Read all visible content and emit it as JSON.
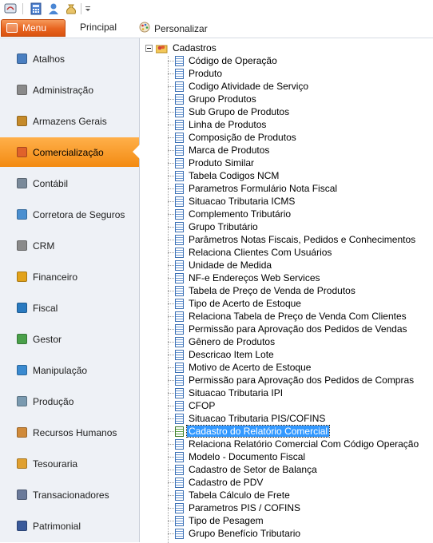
{
  "toolbar": {
    "icons": [
      "app-icon",
      "calculator-icon",
      "user-icon",
      "money-bag-icon",
      "customize-dropdown-icon"
    ]
  },
  "tabs": {
    "menu_label": "Menu",
    "principal_label": "Principal",
    "personalizar_label": "Personalizar"
  },
  "nav": {
    "active_index": 3,
    "items": [
      {
        "label": "Atalhos",
        "icon": "shortcut-icon",
        "color": "#4a7fc1"
      },
      {
        "label": "Administração",
        "icon": "admin-icon",
        "color": "#8a8a8a"
      },
      {
        "label": "Armazens Gerais",
        "icon": "warehouse-icon",
        "color": "#c58a2a"
      },
      {
        "label": "Comercialização",
        "icon": "store-icon",
        "color": "#e0622a"
      },
      {
        "label": "Contábil",
        "icon": "ledger-icon",
        "color": "#7a8a9a"
      },
      {
        "label": "Corretora de Seguros",
        "icon": "insurance-icon",
        "color": "#4a8fd0"
      },
      {
        "label": "CRM",
        "icon": "crm-icon",
        "color": "#8a8a8a"
      },
      {
        "label": "Financeiro",
        "icon": "coin-icon",
        "color": "#e2a21a"
      },
      {
        "label": "Fiscal",
        "icon": "fiscal-book-icon",
        "color": "#2a7ac0"
      },
      {
        "label": "Gestor",
        "icon": "chart-icon",
        "color": "#4aa04a"
      },
      {
        "label": "Manipulação",
        "icon": "capsule-icon",
        "color": "#3a8ad0"
      },
      {
        "label": "Produção",
        "icon": "factory-icon",
        "color": "#7a9ab0"
      },
      {
        "label": "Recursos Humanos",
        "icon": "people-icon",
        "color": "#d08a3a"
      },
      {
        "label": "Tesouraria",
        "icon": "treasury-icon",
        "color": "#e0a030"
      },
      {
        "label": "Transacionadores",
        "icon": "handshake-icon",
        "color": "#6a7a9a"
      },
      {
        "label": "Patrimonial",
        "icon": "asset-icon",
        "color": "#3a5a9a"
      }
    ]
  },
  "tree": {
    "root_label": "Cadastros",
    "selected_index": 29,
    "items": [
      "Código de Operação",
      "Produto",
      "Codigo Atividade de Serviço",
      "Grupo Produtos",
      "Sub Grupo de Produtos",
      "Linha de Produtos",
      "Composição de Produtos",
      "Marca de Produtos",
      "Produto Similar",
      "Tabela Codigos NCM",
      "Parametros Formulário Nota Fiscal",
      "Situacao Tributaria ICMS",
      "Complemento Tributário",
      "Grupo Tributário",
      "Parâmetros Notas Fiscais, Pedidos e Conhecimentos",
      "Relaciona Clientes Com Usuários",
      "Unidade de Medida",
      "NF-e Endereços Web Services",
      "Tabela de Preço de Venda de Produtos",
      "Tipo de Acerto de Estoque",
      "Relaciona Tabela de Preço de Venda Com Clientes",
      "Permissão para Aprovação dos Pedidos de Vendas",
      "Gênero de Produtos",
      "Descricao Item Lote",
      "Motivo de Acerto de Estoque",
      "Permissão para Aprovação dos Pedidos de Compras",
      "Situacao Tributaria IPI",
      "CFOP",
      "Situacao Tributaria PIS/COFINS",
      "Cadastro do Relatório Comercial",
      "Relaciona Relatório Comercial Com Código Operação",
      "Modelo - Documento Fiscal",
      "Cadastro de Setor de Balança",
      "Cadastro de PDV",
      "Tabela Cálculo de Frete",
      "Parametros PIS / COFINS",
      "Tipo de Pesagem",
      "Grupo Benefício Tributario"
    ]
  }
}
